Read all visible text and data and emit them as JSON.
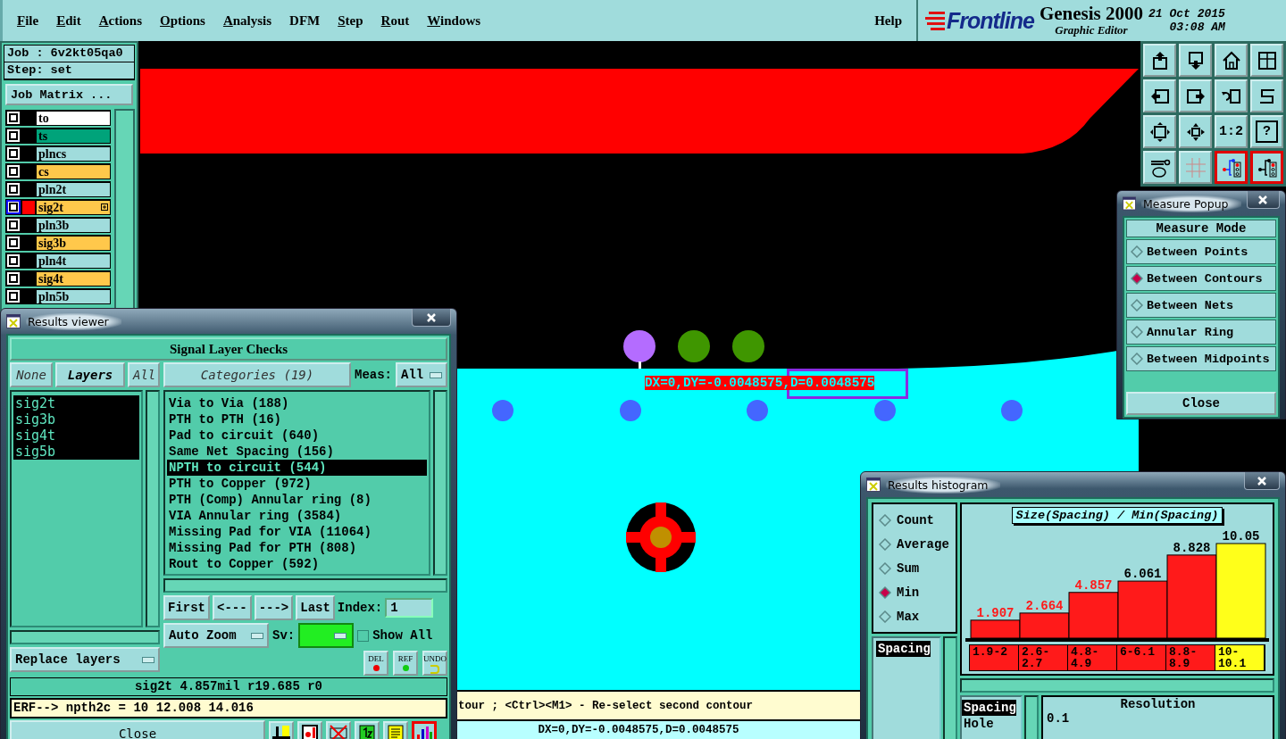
{
  "menu": [
    {
      "label": "File",
      "mnemonic": true
    },
    {
      "label": "Edit",
      "mnemonic": true
    },
    {
      "label": "Actions",
      "mnemonic": true
    },
    {
      "label": "Options",
      "mnemonic": true
    },
    {
      "label": "Analysis",
      "mnemonic": true
    },
    {
      "label": "DFM",
      "mnemonic": false
    },
    {
      "label": "Step",
      "mnemonic": true
    },
    {
      "label": "Rout",
      "mnemonic": true
    },
    {
      "label": "Windows",
      "mnemonic": true
    }
  ],
  "help": "Help",
  "header": {
    "logo": "Frontline",
    "product": "Genesis 2000",
    "subtitle": "Graphic Editor",
    "date": "21 Oct 2015",
    "time": "03:08 AM"
  },
  "job": {
    "job": "Job : 6v2kt05qa0",
    "step": "Step: set",
    "matrix_button": "Job Matrix ..."
  },
  "layers": [
    {
      "name": "to",
      "color": "#ffffff",
      "selected": false
    },
    {
      "name": "ts",
      "color": "#00a37a",
      "selected": false
    },
    {
      "name": "plncs",
      "color": "#a0dcdc",
      "selected": false
    },
    {
      "name": "cs",
      "color": "#ffc84b",
      "selected": false
    },
    {
      "name": "pln2t",
      "color": "#a0dcdc",
      "selected": false
    },
    {
      "name": "sig2t",
      "color": "#ffc84b",
      "selected": true
    },
    {
      "name": "pln3b",
      "color": "#a0dcdc",
      "selected": false
    },
    {
      "name": "sig3b",
      "color": "#ffc84b",
      "selected": false
    },
    {
      "name": "pln4t",
      "color": "#a0dcdc",
      "selected": false
    },
    {
      "name": "sig4t",
      "color": "#ffc84b",
      "selected": false
    },
    {
      "name": "pln5b",
      "color": "#a0dcdc",
      "selected": false
    }
  ],
  "canvas": {
    "measure_label": "DX=0,DY=-0.0048575,D=0.0048575"
  },
  "prompt": "tour ; <Ctrl><M1> - Re-select second contour",
  "status": "DX=0,DY=-0.0048575,D=0.0048575",
  "toolbar": {
    "scale_label": "1:2",
    "help_label": "?",
    "toggles": [
      {
        "on": true
      },
      {
        "on": true
      }
    ]
  },
  "results_viewer": {
    "title": "Results viewer",
    "heading": "Signal Layer Checks",
    "layer_buttons": [
      {
        "label": "None",
        "selected": false
      },
      {
        "label": "Layers",
        "selected": true
      },
      {
        "label": "All",
        "selected": false
      }
    ],
    "categories_button": "Categories (19)",
    "meas_label": "Meas:",
    "meas_value": "All",
    "layers": [
      {
        "name": "sig2t",
        "selected": true
      },
      {
        "name": "sig3b",
        "selected": true
      },
      {
        "name": "sig4t",
        "selected": true
      },
      {
        "name": "sig5b",
        "selected": true
      }
    ],
    "categories": [
      {
        "name": "Via to Via (188)",
        "selected": false
      },
      {
        "name": "PTH to PTH (16)",
        "selected": false
      },
      {
        "name": "Pad to circuit (640)",
        "selected": false
      },
      {
        "name": "Same Net Spacing (156)",
        "selected": false
      },
      {
        "name": "NPTH to circuit (544)",
        "selected": true
      },
      {
        "name": "PTH to Copper (972)",
        "selected": false
      },
      {
        "name": "PTH (Comp) Annular ring (8)",
        "selected": false
      },
      {
        "name": "VIA Annular ring (3584)",
        "selected": false
      },
      {
        "name": "Missing Pad for VIA (11064)",
        "selected": false
      },
      {
        "name": "Missing Pad for PTH (808)",
        "selected": false
      },
      {
        "name": "Rout to Copper (592)",
        "selected": false
      }
    ],
    "nav": [
      "First",
      "<---",
      "--->",
      "Last"
    ],
    "index_label": "Index:",
    "index_value": "1",
    "zoom_mode": "Auto Zoom",
    "sv_label": "Sv:",
    "show_all": {
      "label": "Show All",
      "checked": false
    },
    "tools": [
      {
        "label": "DEL",
        "kind": "delete"
      },
      {
        "label": "REF",
        "kind": "reference"
      },
      {
        "label": "UNDO",
        "kind": "undo"
      }
    ],
    "replace": "Replace layers",
    "info": "sig2t 4.857mil r19.685 r0",
    "erf": "ERF--> npth2c = 10 12.008 14.016",
    "close": "Close",
    "bottom_tools": [
      {
        "kind": "figure",
        "selected": false
      },
      {
        "kind": "report",
        "selected": false
      },
      {
        "kind": "no-ref",
        "selected": false
      },
      {
        "kind": "page",
        "selected": false
      },
      {
        "kind": "note",
        "selected": false
      },
      {
        "kind": "chart",
        "selected": true
      }
    ]
  },
  "measure_popup": {
    "title": "Measure Popup",
    "heading": "Measure Mode",
    "modes": [
      {
        "label": "Between Points",
        "selected": false
      },
      {
        "label": "Between Contours",
        "selected": true
      },
      {
        "label": "Between Nets",
        "selected": false
      },
      {
        "label": "Annular Ring",
        "selected": false
      },
      {
        "label": "Between Midpoints",
        "selected": false
      }
    ],
    "close": "Close"
  },
  "histogram": {
    "title": "Results histogram",
    "modes": [
      {
        "label": "Count",
        "selected": false
      },
      {
        "label": "Average",
        "selected": false
      },
      {
        "label": "Sum",
        "selected": false
      },
      {
        "label": "Min",
        "selected": true
      },
      {
        "label": "Max",
        "selected": false
      }
    ],
    "measures": [
      {
        "name": "Spacing",
        "selected": true
      }
    ],
    "chart_data": {
      "type": "bar",
      "title": "Size(Spacing) / Min(Spacing)",
      "categories": [
        "1.9-2",
        "2.6-2.7",
        "4.8-4.9",
        "6-6.1",
        "8.8-8.9",
        "10-10.1"
      ],
      "values": [
        1.907,
        2.664,
        4.857,
        6.061,
        8.828,
        10.05
      ],
      "data_labels": true
    },
    "bins": [
      {
        "flagged": true,
        "selected": false
      },
      {
        "flagged": true,
        "selected": false
      },
      {
        "flagged": true,
        "selected": false
      },
      {
        "flagged": false,
        "selected": false
      },
      {
        "flagged": false,
        "selected": false
      },
      {
        "flagged": false,
        "selected": true
      }
    ],
    "attributes": [
      {
        "name": "Spacing",
        "selected": true
      },
      {
        "name": "Hole",
        "selected": false
      }
    ],
    "resolution_label": "Resolution",
    "resolution_value": "0.1"
  }
}
